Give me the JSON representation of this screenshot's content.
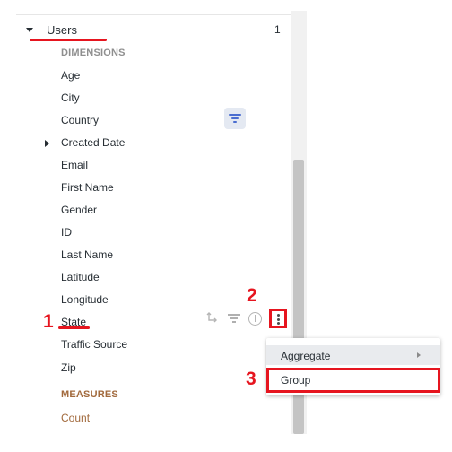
{
  "view": {
    "label": "Users",
    "count": "1"
  },
  "dimensions": {
    "section_label": "DIMENSIONS",
    "fields": [
      {
        "label": "Age"
      },
      {
        "label": "City"
      },
      {
        "label": "Country"
      },
      {
        "label": "Created Date"
      },
      {
        "label": "Email"
      },
      {
        "label": "First Name"
      },
      {
        "label": "Gender"
      },
      {
        "label": "ID"
      },
      {
        "label": "Last Name"
      },
      {
        "label": "Latitude"
      },
      {
        "label": "Longitude"
      },
      {
        "label": "State"
      },
      {
        "label": "Traffic Source"
      },
      {
        "label": "Zip"
      }
    ]
  },
  "measures": {
    "section_label": "MEASURES",
    "fields": [
      {
        "label": "Count"
      }
    ]
  },
  "context_menu": {
    "items": [
      {
        "label": "Aggregate"
      },
      {
        "label": "Group"
      }
    ]
  },
  "annotations": {
    "step1": "1",
    "step2": "2",
    "step3": "3"
  },
  "colors": {
    "annotation_red": "#e6151f",
    "measure_brown": "#a26a3d",
    "filter_active_bg": "#e4e9f2",
    "filter_active_icon": "#4a6dd0"
  },
  "icons": [
    "caret-down-icon",
    "caret-right-icon",
    "filter-icon",
    "pivot-icon",
    "info-icon",
    "more-vertical-icon",
    "submenu-chevron-icon"
  ]
}
